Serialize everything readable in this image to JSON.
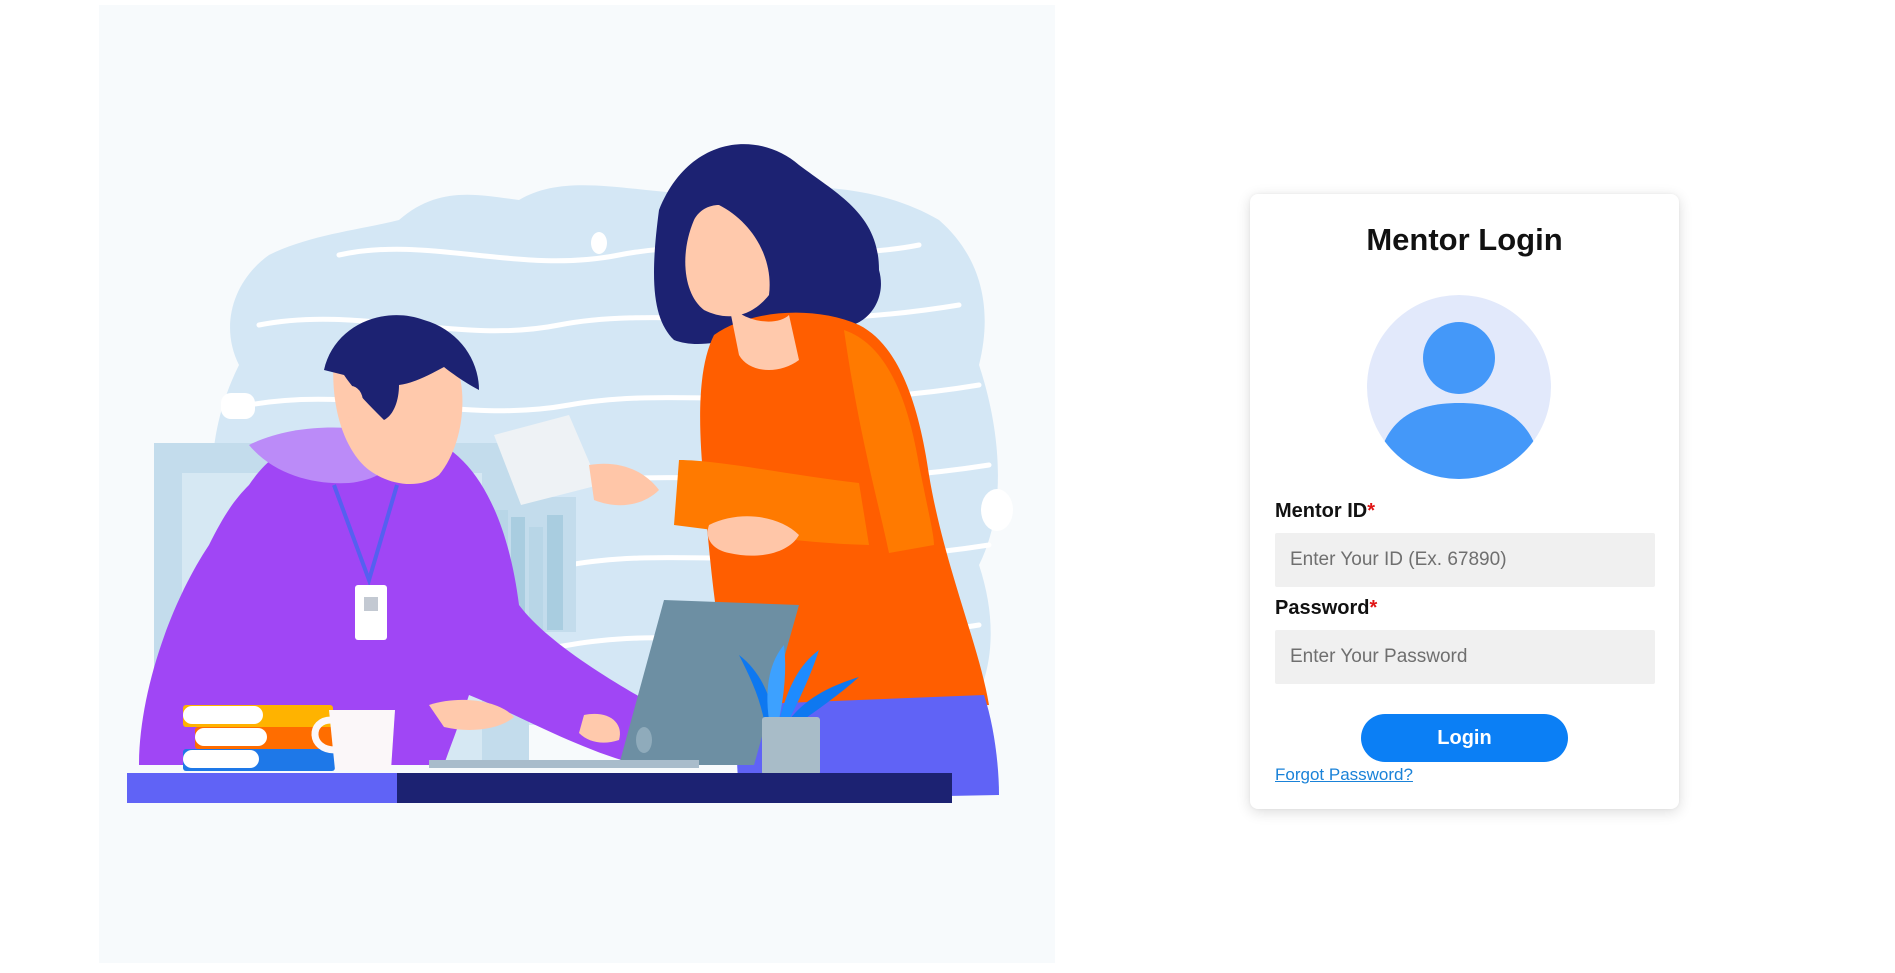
{
  "login": {
    "title": "Mentor Login",
    "mentor_id_label": "Mentor ID",
    "mentor_id_placeholder": "Enter Your ID (Ex. 67890)",
    "mentor_id_value": "",
    "password_label": "Password",
    "password_placeholder": "Enter Your Password",
    "password_value": "",
    "required_marker": "*",
    "login_button_label": "Login",
    "forgot_password_link": "Forgot Password?"
  },
  "icons": {
    "avatar": "user-silhouette-icon",
    "illustration": "mentoring-illustration"
  },
  "colors": {
    "accent": "#0b7ff5",
    "link": "#1a82d8",
    "required": "#e01515",
    "input_background": "#f0f0f0",
    "avatar_background": "#e2e9fb",
    "avatar_figure": "#4498f9"
  }
}
